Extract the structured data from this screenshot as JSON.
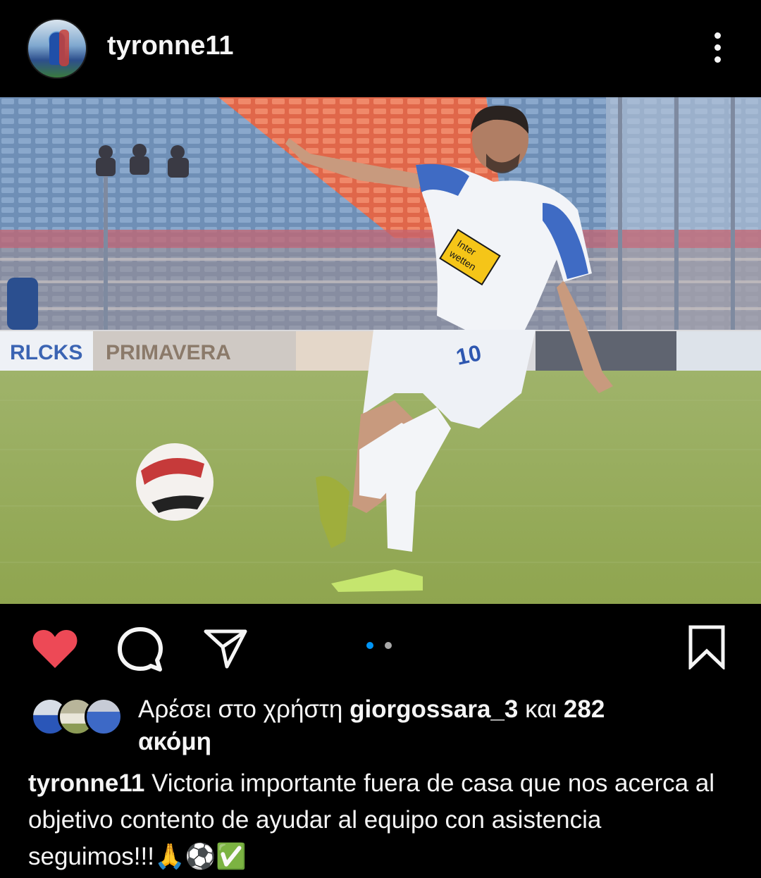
{
  "post": {
    "username": "tyronne11",
    "likes": {
      "prefix": "Αρέσει στο χρήστη",
      "liker": "giorgossara_3",
      "joiner": "και",
      "count": "282",
      "suffix": "ακόμη"
    },
    "caption": {
      "username": "tyronne11",
      "text": "Victoria importante fuera de casa que nos acerca al objetivo contento de ayudar al equipo con asistencia seguimos!!!🙏⚽✅"
    },
    "photo": {
      "banner_left": "RLCKS",
      "banner_mid": "PRIMAVERA",
      "shirt_sponsor_line1": "Inter",
      "shirt_sponsor_line2": "wetten",
      "shirt_number": "10"
    },
    "carousel": {
      "count": 2,
      "active": 1
    }
  },
  "icons": {
    "like": "heart-icon",
    "comment": "comment-bubble-icon",
    "share": "paper-plane-icon",
    "save": "bookmark-icon",
    "more": "more-vertical-icon"
  },
  "colors": {
    "background": "#000000",
    "like_active": "#ed4956",
    "carousel_active": "#0095f6",
    "carousel_inactive": "#a8a8a8"
  }
}
